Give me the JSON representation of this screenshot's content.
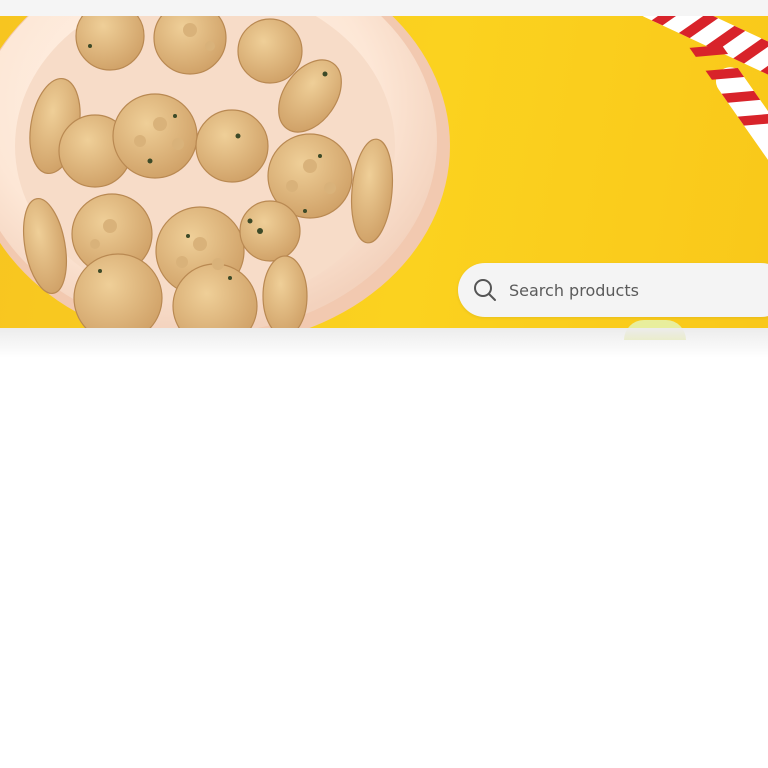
{
  "hero": {
    "image_description_icon": "dog-biscuits-bowl-image",
    "rope_toy_icon": "rope-toy-image",
    "background_color": "#fbd21f"
  },
  "search": {
    "placeholder": "Search products",
    "value": "",
    "icon": "search-icon"
  }
}
